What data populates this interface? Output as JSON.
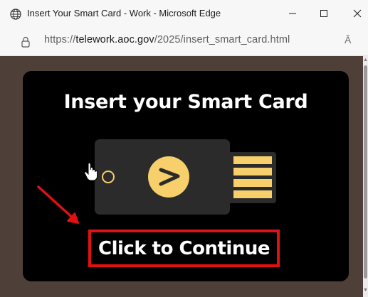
{
  "window": {
    "title": "Insert Your Smart Card - Work - Microsoft Edge",
    "buttons": [
      "minimize",
      "maximize",
      "close"
    ]
  },
  "address": {
    "prefix": "https://",
    "host": "telework.aoc.gov",
    "path": "/2025/insert_smart_card.html",
    "read_aloud": "Ă"
  },
  "page": {
    "headline": "Insert your Smart Card",
    "cta_label": "Click to Continue",
    "background_color": "#4e4038",
    "panel_color": "#000000",
    "accent_color": "#f7cf6b",
    "highlight_color": "#e21010"
  },
  "icons": {
    "globe": "globe-icon",
    "lock": "lock-icon",
    "security_key": "usb-security-key-icon",
    "hand_cursor": "hand-pointer-icon",
    "arrow": "red-arrow-annotation"
  }
}
